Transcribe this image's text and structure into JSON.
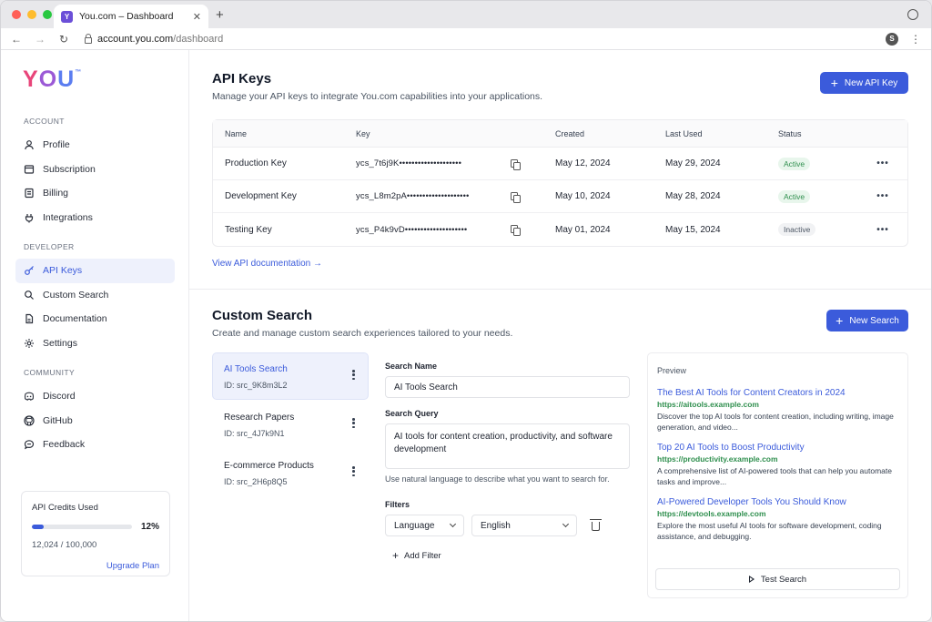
{
  "browser": {
    "tab_title": "You.com – Dashboard",
    "favicon_letter": "Y",
    "url_domain": "account.you.com",
    "url_path": "/dashboard",
    "extension_letter": "S"
  },
  "sidebar": {
    "logo": {
      "y": "Y",
      "o": "O",
      "u": "U",
      "tm": "™"
    },
    "sections": [
      {
        "label": "ACCOUNT",
        "items": [
          "Profile",
          "Subscription",
          "Billing",
          "Integrations"
        ]
      },
      {
        "label": "DEVELOPER",
        "items": [
          "API Keys",
          "Custom Search",
          "Documentation",
          "Settings"
        ]
      },
      {
        "label": "COMMUNITY",
        "items": [
          "Discord",
          "GitHub",
          "Feedback"
        ]
      }
    ],
    "active_item": "API Keys",
    "credits": {
      "title": "API Credits Used",
      "percent_label": "12%",
      "percent": 12,
      "count": "12,024 / 100,000",
      "upgrade": "Upgrade Plan"
    }
  },
  "api_keys": {
    "title": "API Keys",
    "subtitle": "Manage your API keys to integrate You.com capabilities into your applications.",
    "new_button": "New API Key",
    "columns": [
      "Name",
      "Key",
      "Created",
      "Last Used",
      "Status"
    ],
    "rows": [
      {
        "name": "Production Key",
        "key": "ycs_7t6j9K••••••••••••••••••••",
        "created": "May 12, 2024",
        "last_used": "May 29, 2024",
        "status": "Active"
      },
      {
        "name": "Development Key",
        "key": "ycs_L8m2pA••••••••••••••••••••",
        "created": "May 10, 2024",
        "last_used": "May 28, 2024",
        "status": "Active"
      },
      {
        "name": "Testing Key",
        "key": "ycs_P4k9vD••••••••••••••••••••",
        "created": "May 01, 2024",
        "last_used": "May 15, 2024",
        "status": "Inactive"
      }
    ],
    "more_glyph": "•••",
    "doc_link": "View API documentation →"
  },
  "custom_search": {
    "title": "Custom Search",
    "subtitle": "Create and manage custom search experiences tailored to your needs.",
    "new_button": "New Search",
    "searches": [
      {
        "name": "AI Tools Search",
        "id": "ID: src_9K8m3L2"
      },
      {
        "name": "Research Papers",
        "id": "ID: src_4J7k9N1"
      },
      {
        "name": "E-commerce Products",
        "id": "ID: src_2H6p8Q5"
      }
    ],
    "form": {
      "name_label": "Search Name",
      "name_value": "AI Tools Search",
      "query_label": "Search Query",
      "query_value": "AI tools for content creation, productivity, and software development",
      "hint": "Use natural language to describe what you want to search for.",
      "filters_label": "Filters",
      "filter_field": "Language",
      "filter_value": "English",
      "add_filter": "Add Filter"
    },
    "preview": {
      "label": "Preview",
      "results": [
        {
          "title": "The Best AI Tools for Content Creators in 2024",
          "url": "https://aitools.example.com",
          "desc": "Discover the top AI tools for content creation, including writing, image generation, and video..."
        },
        {
          "title": "Top 20 AI Tools to Boost Productivity",
          "url": "https://productivity.example.com",
          "desc": "A comprehensive list of AI-powered tools that can help you automate tasks and improve..."
        },
        {
          "title": "AI-Powered Developer Tools You Should Know",
          "url": "https://devtools.example.com",
          "desc": "Explore the most useful AI tools for software development, coding assistance, and debugging."
        }
      ],
      "test_button": "Test Search"
    }
  },
  "colors": {
    "accent": "#3b5bdb",
    "active_badge": "#2f8f4e",
    "logo_pink": "#e8457a",
    "logo_purple": "#9b59d6",
    "logo_blue": "#5b7df0"
  }
}
